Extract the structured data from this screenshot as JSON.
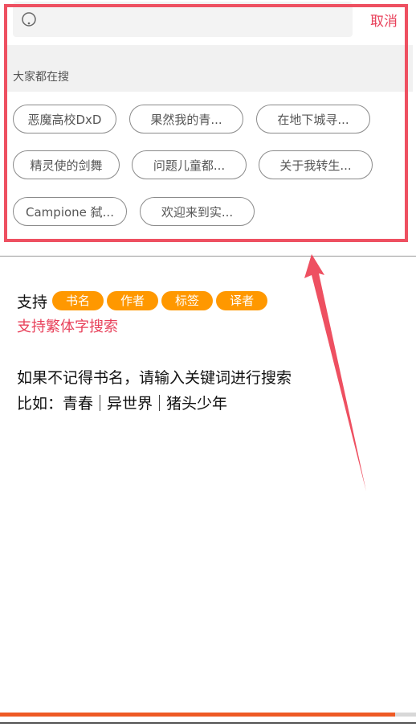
{
  "search": {
    "placeholder": "",
    "cancel_label": "取消"
  },
  "hot": {
    "title": "大家都在搜",
    "chips": [
      "恶魔高校DxD",
      "果然我的青...",
      "在地下城寻...",
      "精灵使的剑舞",
      "问题儿童都...",
      "关于我转生...",
      "Campione 弑...",
      "欢迎来到实..."
    ]
  },
  "help": {
    "support_label": "支持",
    "tags": [
      "书名",
      "作者",
      "标签",
      "译者"
    ],
    "traditional_note": "支持繁体字搜索",
    "hint": "如果不记得书名，请输入关键词进行搜索",
    "example_label": "比如：",
    "examples": [
      "青春",
      "异世界",
      "猪头少年"
    ]
  },
  "progress": 0.95,
  "colors": {
    "accent_red": "#e8405a",
    "tag_orange": "#ff9800",
    "annotation_red": "#ee5061",
    "progress_orange": "#ee5a24"
  }
}
